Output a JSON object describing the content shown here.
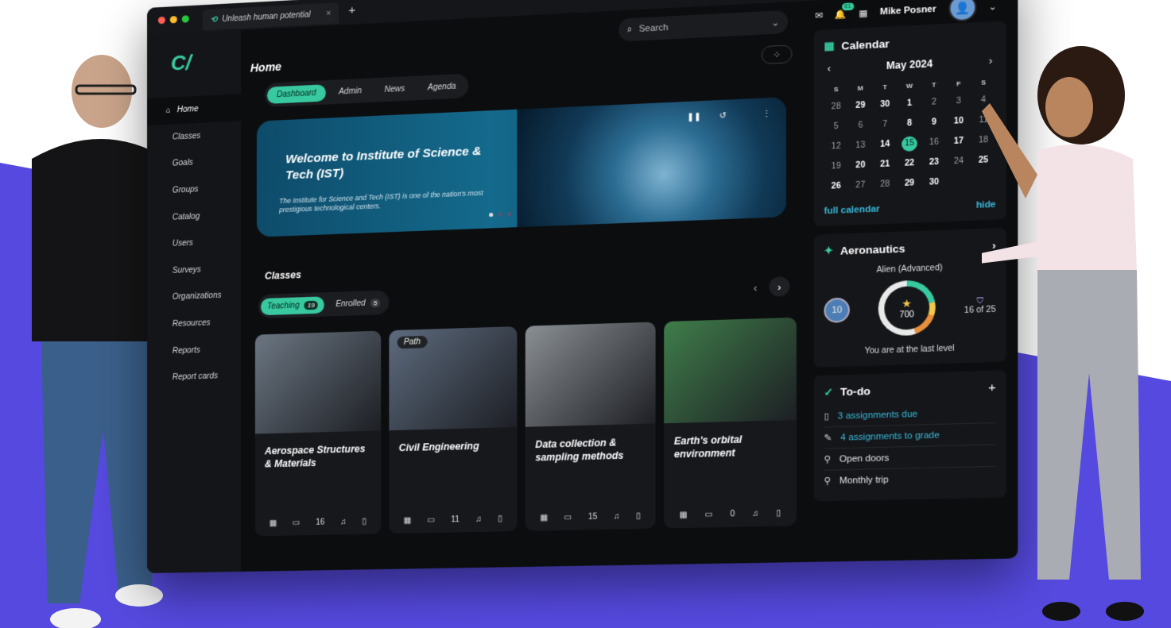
{
  "browser": {
    "tab_title": "Unleash human potential",
    "tab_close": "×",
    "new_tab": "+"
  },
  "header": {
    "search_placeholder": "Search",
    "notification_count": "61",
    "user_name": "Mike Posner"
  },
  "sidebar": {
    "items": [
      {
        "label": "Home",
        "icon": "home-icon"
      },
      {
        "label": "Classes",
        "icon": "classes-icon"
      },
      {
        "label": "Goals",
        "icon": "goals-icon"
      },
      {
        "label": "Groups",
        "icon": "groups-icon"
      },
      {
        "label": "Catalog",
        "icon": "catalog-icon"
      },
      {
        "label": "Users",
        "icon": "users-icon"
      },
      {
        "label": "Surveys",
        "icon": "surveys-icon"
      },
      {
        "label": "Organizations",
        "icon": "organizations-icon"
      },
      {
        "label": "Resources",
        "icon": "resources-icon"
      },
      {
        "label": "Reports",
        "icon": "reports-icon"
      },
      {
        "label": "Report cards",
        "icon": "report-cards-icon"
      }
    ]
  },
  "main": {
    "title": "Home",
    "tabs": [
      "Dashboard",
      "Admin",
      "News",
      "Agenda"
    ],
    "hero": {
      "title": "Welcome to Institute of Science & Tech (IST)",
      "text": "The Institute for Science and Tech (IST) is one of the nation's most prestigious technological centers."
    }
  },
  "classes": {
    "title": "Classes",
    "tabs": [
      {
        "label": "Teaching",
        "count": "19"
      },
      {
        "label": "Enrolled",
        "count": "5"
      }
    ],
    "cards": [
      {
        "title": "Aerospace Structures & Materials",
        "tag": "",
        "count": "16",
        "img_color": "#6b7682"
      },
      {
        "title": "Civil Engineering",
        "tag": "Path",
        "count": "11",
        "img_color": "#5d6b7e"
      },
      {
        "title": "Data collection & sampling methods",
        "tag": "",
        "count": "15",
        "img_color": "#8a8f94"
      },
      {
        "title": "Earth's orbital environment",
        "tag": "",
        "count": "0",
        "img_color": "#3f7d4a"
      }
    ]
  },
  "calendar": {
    "title": "Calendar",
    "month": "May 2024",
    "dow": [
      "S",
      "M",
      "T",
      "W",
      "T",
      "F",
      "S"
    ],
    "days": [
      {
        "d": "28",
        "b": false
      },
      {
        "d": "29",
        "b": true
      },
      {
        "d": "30",
        "b": true
      },
      {
        "d": "1",
        "b": true
      },
      {
        "d": "2",
        "b": false
      },
      {
        "d": "3",
        "b": false
      },
      {
        "d": "4",
        "b": false
      },
      {
        "d": "5",
        "b": false
      },
      {
        "d": "6",
        "b": false
      },
      {
        "d": "7",
        "b": false
      },
      {
        "d": "8",
        "b": true
      },
      {
        "d": "9",
        "b": true
      },
      {
        "d": "10",
        "b": true
      },
      {
        "d": "11",
        "b": false
      },
      {
        "d": "12",
        "b": false
      },
      {
        "d": "13",
        "b": false
      },
      {
        "d": "14",
        "b": true
      },
      {
        "d": "15",
        "b": false,
        "today": true
      },
      {
        "d": "16",
        "b": false
      },
      {
        "d": "17",
        "b": true
      },
      {
        "d": "18",
        "b": false
      },
      {
        "d": "19",
        "b": false
      },
      {
        "d": "20",
        "b": true
      },
      {
        "d": "21",
        "b": true
      },
      {
        "d": "22",
        "b": true
      },
      {
        "d": "23",
        "b": true
      },
      {
        "d": "24",
        "b": false
      },
      {
        "d": "25",
        "b": true
      },
      {
        "d": "26",
        "b": true
      },
      {
        "d": "27",
        "b": false
      },
      {
        "d": "28",
        "b": false
      },
      {
        "d": "29",
        "b": true
      },
      {
        "d": "30",
        "b": true
      },
      {
        "d": "",
        "b": false
      },
      {
        "d": "",
        "b": false
      }
    ],
    "full_calendar": "full calendar",
    "hide": "hide"
  },
  "aeronautics": {
    "title": "Aeronautics",
    "subtitle": "Alien (Advanced)",
    "points": "700",
    "level": "16 of 25",
    "avatar_level": "10",
    "footer": "You are at the last level"
  },
  "todo": {
    "title": "To-do",
    "add": "+",
    "items": [
      {
        "label": "3 assignments due",
        "link": true
      },
      {
        "label": "4 assignments to grade",
        "link": true
      },
      {
        "label": "Open doors",
        "link": false
      },
      {
        "label": "Monthly trip",
        "link": false
      }
    ]
  },
  "colors": {
    "accent": "#38c9a0",
    "link": "#38b8d8",
    "background_band": "#5549e0",
    "app_bg": "#0c0d0f"
  }
}
